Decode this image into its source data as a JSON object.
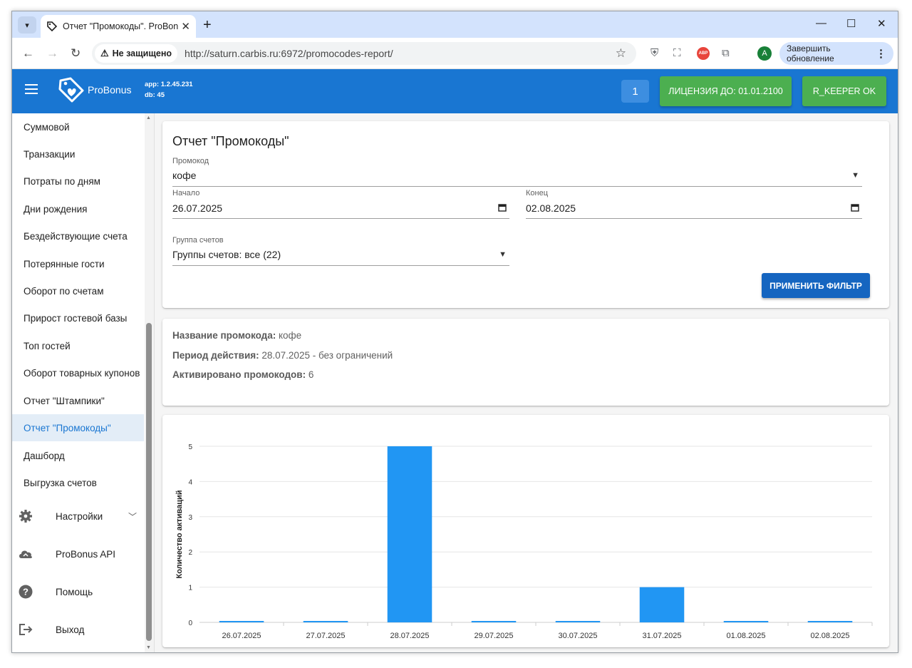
{
  "browser": {
    "tab_title": "Отчет \"Промокоды\". ProBonus",
    "tab_close": "✕",
    "new_tab": "+",
    "security_label": "Не защищено",
    "url": "http://saturn.carbis.ru:6972/promocodes-report/",
    "update_label": "Завершить обновление",
    "profile_initial": "A",
    "abp_label": "ABP"
  },
  "header": {
    "brand": "ProBonus",
    "app_version": "app: 1.2.45.231",
    "db_version": "db: 45",
    "count": "1",
    "license_label": "ЛИЦЕНЗИЯ ДО: 01.01.2100",
    "keeper_label": "R_KEEPER OK"
  },
  "sidebar": {
    "items": [
      {
        "label": "Суммовой"
      },
      {
        "label": "Транзакции"
      },
      {
        "label": "Потраты по дням"
      },
      {
        "label": "Дни рождения"
      },
      {
        "label": "Бездействующие счета"
      },
      {
        "label": "Потерянные гости"
      },
      {
        "label": "Оборот по счетам"
      },
      {
        "label": "Прирост гостевой базы"
      },
      {
        "label": "Топ гостей"
      },
      {
        "label": "Оборот товарных купонов"
      },
      {
        "label": "Отчет \"Штампики\""
      },
      {
        "label": "Отчет \"Промокоды\""
      },
      {
        "label": "Дашборд"
      },
      {
        "label": "Выгрузка счетов"
      }
    ],
    "sections": [
      {
        "label": "Настройки"
      },
      {
        "label": "ProBonus API"
      },
      {
        "label": "Помощь"
      },
      {
        "label": "Выход"
      }
    ]
  },
  "filter": {
    "title": "Отчет \"Промокоды\"",
    "promo_label": "Промокод",
    "promo_value": "кофе",
    "start_label": "Начало",
    "start_value": "26.07.2025",
    "end_label": "Конец",
    "end_value": "02.08.2025",
    "group_label": "Группа счетов",
    "group_value": "Группы счетов: все (22)",
    "apply_label": "ПРИМЕНИТЬ ФИЛЬТР"
  },
  "summary": {
    "name_label": "Название промокода:",
    "name_value": "кофе",
    "period_label": "Период действия:",
    "period_value": "28.07.2025 - без ограничений",
    "activated_label": "Активировано промокодов:",
    "activated_value": "6"
  },
  "colors": {
    "primary": "#1976d2",
    "green": "#4caf50",
    "bar": "#2196f3",
    "button": "#1565c0"
  },
  "chart_data": {
    "type": "bar",
    "categories": [
      "26.07.2025",
      "27.07.2025",
      "28.07.2025",
      "29.07.2025",
      "30.07.2025",
      "31.07.2025",
      "01.08.2025",
      "02.08.2025"
    ],
    "values": [
      0,
      0,
      5,
      0,
      0,
      1,
      0,
      0
    ],
    "ylabel": "Количество активаций",
    "xlabel": "",
    "ylim": [
      0,
      5
    ],
    "yticks": [
      "0",
      "1",
      "2",
      "3",
      "4",
      "5"
    ],
    "grid": true,
    "legend": "none"
  }
}
